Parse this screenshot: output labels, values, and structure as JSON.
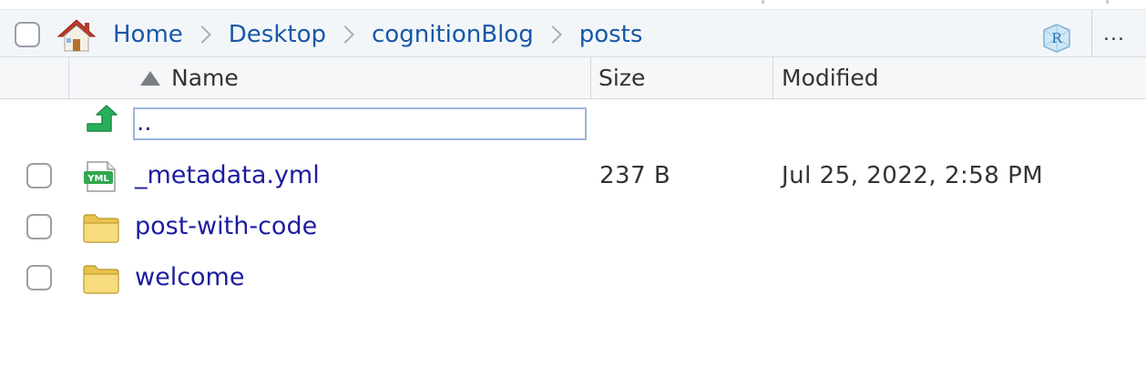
{
  "breadcrumb": {
    "items": [
      "Home",
      "Desktop",
      "cognitionBlog",
      "posts"
    ]
  },
  "toolbar": {
    "more_label": "..."
  },
  "columns": {
    "name": "Name",
    "size": "Size",
    "modified": "Modified",
    "sort": "ascending"
  },
  "parent_dir": {
    "label": ".."
  },
  "files": [
    {
      "name": "_metadata.yml",
      "size": "237 B",
      "modified": "Jul 25, 2022, 2:58 PM",
      "icon": "yml-file-icon"
    },
    {
      "name": "post-with-code",
      "size": "",
      "modified": "",
      "icon": "folder-icon"
    },
    {
      "name": "welcome",
      "size": "",
      "modified": "",
      "icon": "folder-icon"
    }
  ],
  "icons": {
    "yml_badge": "YML"
  },
  "colors": {
    "link": "#1c1ca0",
    "crumb": "#1758a7",
    "header_bg": "#f3f6f9",
    "up_arrow": "#27b05b",
    "folder": "#f1cf5f"
  }
}
